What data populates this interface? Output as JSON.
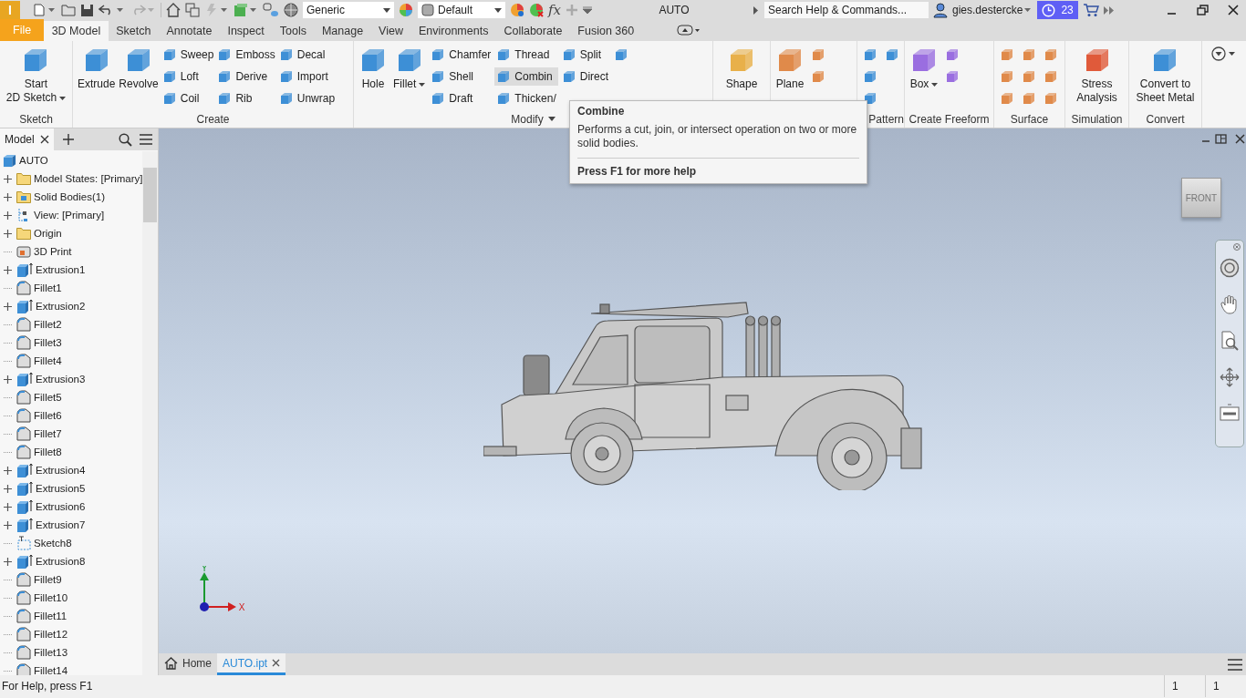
{
  "app": {
    "logo": "I",
    "title": "AUTO"
  },
  "quick_access": {
    "material": "Generic",
    "appearance": "Default",
    "function_label": "fx"
  },
  "search": {
    "placeholder": "Search Help & Commands..."
  },
  "user": {
    "name": "gies.destercke"
  },
  "trial_badge": "23",
  "menu_tabs": [
    {
      "label": "File",
      "kind": "file",
      "selected": false
    },
    {
      "label": "3D Model",
      "kind": "tab",
      "selected": true
    },
    {
      "label": "Sketch",
      "kind": "tab",
      "selected": false
    },
    {
      "label": "Annotate",
      "kind": "tab",
      "selected": false
    },
    {
      "label": "Inspect",
      "kind": "tab",
      "selected": false
    },
    {
      "label": "Tools",
      "kind": "tab",
      "selected": false
    },
    {
      "label": "Manage",
      "kind": "tab",
      "selected": false
    },
    {
      "label": "View",
      "kind": "tab",
      "selected": false
    },
    {
      "label": "Environments",
      "kind": "tab",
      "selected": false
    },
    {
      "label": "Collaborate",
      "kind": "tab",
      "selected": false
    },
    {
      "label": "Fusion 360",
      "kind": "tab",
      "selected": false
    }
  ],
  "ribbon_groups": [
    {
      "label": "Sketch",
      "menu": false,
      "tools": [
        {
          "kind": "large",
          "label": "Start\n2D Sketch",
          "dropdown": true,
          "hovered": false
        }
      ]
    },
    {
      "label": "Create",
      "menu": false,
      "tools": [
        {
          "kind": "large",
          "label": "Extrude",
          "dropdown": false,
          "hovered": false
        },
        {
          "kind": "large",
          "label": "Revolve",
          "dropdown": false,
          "hovered": false
        },
        {
          "kind": "stack",
          "items": [
            {
              "label": "Sweep",
              "hovered": false
            },
            {
              "label": "Loft",
              "hovered": false
            },
            {
              "label": "Coil",
              "hovered": false
            }
          ]
        },
        {
          "kind": "stack",
          "items": [
            {
              "label": "Emboss",
              "hovered": false
            },
            {
              "label": "Derive",
              "hovered": false
            },
            {
              "label": "Rib",
              "hovered": false
            }
          ]
        },
        {
          "kind": "stack",
          "items": [
            {
              "label": "Decal",
              "hovered": false
            },
            {
              "label": "Import",
              "hovered": false
            },
            {
              "label": "Unwrap",
              "hovered": false
            }
          ]
        }
      ]
    },
    {
      "label": "Modify",
      "menu": true,
      "tools": [
        {
          "kind": "large",
          "label": "Hole",
          "dropdown": false,
          "hovered": false
        },
        {
          "kind": "large",
          "label": "Fillet",
          "dropdown": true,
          "hovered": false
        },
        {
          "kind": "stack",
          "items": [
            {
              "label": "Chamfer",
              "hovered": false
            },
            {
              "label": "Shell",
              "hovered": false
            },
            {
              "label": "Draft",
              "hovered": false
            }
          ]
        },
        {
          "kind": "stack",
          "items": [
            {
              "label": "Thread",
              "hovered": false
            },
            {
              "label": "Combin",
              "hovered": true
            },
            {
              "label": "Thicken/",
              "hovered": false
            }
          ]
        },
        {
          "kind": "stack",
          "items": [
            {
              "label": "Split",
              "hovered": false
            },
            {
              "label": "Direct",
              "hovered": false
            }
          ]
        },
        {
          "kind": "stack",
          "items": [
            {
              "hovered": false
            }
          ]
        }
      ]
    },
    {
      "tools": [
        {
          "kind": "large",
          "label": "Shape",
          "dropdown": false,
          "hovered": false
        }
      ]
    },
    {
      "tools": [
        {
          "kind": "large",
          "label": "Plane",
          "dropdown": false,
          "hovered": false
        },
        {
          "kind": "stack",
          "items": [
            {
              "hovered": false
            },
            {
              "hovered": false
            }
          ]
        }
      ]
    },
    {
      "label": "Pattern",
      "menu": false,
      "tools": [
        {
          "kind": "stack",
          "items": [
            {
              "hovered": false
            },
            {
              "hovered": false
            },
            {
              "hovered": false
            }
          ]
        },
        {
          "kind": "stack",
          "items": [
            {
              "hovered": false
            }
          ]
        }
      ]
    },
    {
      "label": "Create Freeform",
      "menu": false,
      "tools": [
        {
          "kind": "large",
          "label": "Box",
          "dropdown": true,
          "hovered": false
        },
        {
          "kind": "stack",
          "items": [
            {
              "hovered": false
            },
            {
              "hovered": false
            }
          ]
        }
      ]
    },
    {
      "label": "Surface",
      "menu": false,
      "tools": [
        {
          "kind": "stack",
          "items": [
            {
              "hovered": false
            },
            {
              "hovered": false
            },
            {
              "hovered": false
            }
          ]
        },
        {
          "kind": "stack",
          "items": [
            {
              "hovered": false
            },
            {
              "hovered": false
            },
            {
              "hovered": false
            }
          ]
        },
        {
          "kind": "stack",
          "items": [
            {
              "hovered": false
            },
            {
              "hovered": false
            },
            {
              "hovered": false
            }
          ]
        }
      ]
    },
    {
      "label": "Simulation",
      "menu": false,
      "tools": [
        {
          "kind": "large",
          "label": "Stress\nAnalysis",
          "dropdown": false,
          "hovered": false
        }
      ]
    },
    {
      "label": "Convert",
      "menu": false,
      "tools": [
        {
          "kind": "large",
          "label": "Convert to\nSheet Metal",
          "dropdown": false,
          "hovered": false
        }
      ]
    }
  ],
  "tooltip": {
    "title": "Combine",
    "text": "Performs a cut, join, or intersect operation on two or more solid bodies.",
    "footer": "Press F1 for more help"
  },
  "browser": {
    "tab": "Model",
    "tree": {
      "label": "AUTO",
      "kind": "part",
      "children": [
        {
          "label": "Model States: [Primary]",
          "kind": "folder",
          "expandable": true
        },
        {
          "label": "Solid Bodies(1)",
          "kind": "bodies",
          "expandable": true
        },
        {
          "label": "View: [Primary]",
          "kind": "view",
          "expandable": true
        },
        {
          "label": "Origin",
          "kind": "folder",
          "expandable": true
        },
        {
          "label": "3D Print",
          "kind": "print",
          "expandable": false
        },
        {
          "label": "Extrusion1",
          "kind": "extrusion",
          "expandable": true
        },
        {
          "label": "Fillet1",
          "kind": "fillet",
          "expandable": false
        },
        {
          "label": "Extrusion2",
          "kind": "extrusion",
          "expandable": true
        },
        {
          "label": "Fillet2",
          "kind": "fillet",
          "expandable": false
        },
        {
          "label": "Fillet3",
          "kind": "fillet",
          "expandable": false
        },
        {
          "label": "Fillet4",
          "kind": "fillet",
          "expandable": false
        },
        {
          "label": "Extrusion3",
          "kind": "extrusion",
          "expandable": true
        },
        {
          "label": "Fillet5",
          "kind": "fillet",
          "expandable": false
        },
        {
          "label": "Fillet6",
          "kind": "fillet",
          "expandable": false
        },
        {
          "label": "Fillet7",
          "kind": "fillet",
          "expandable": false
        },
        {
          "label": "Fillet8",
          "kind": "fillet",
          "expandable": false
        },
        {
          "label": "Extrusion4",
          "kind": "extrusion",
          "expandable": true
        },
        {
          "label": "Extrusion5",
          "kind": "extrusion",
          "expandable": true
        },
        {
          "label": "Extrusion6",
          "kind": "extrusion",
          "expandable": true
        },
        {
          "label": "Extrusion7",
          "kind": "extrusion",
          "expandable": true
        },
        {
          "label": "Sketch8",
          "kind": "sketch",
          "expandable": false
        },
        {
          "label": "Extrusion8",
          "kind": "extrusion",
          "expandable": true
        },
        {
          "label": "Fillet9",
          "kind": "fillet",
          "expandable": false
        },
        {
          "label": "Fillet10",
          "kind": "fillet",
          "expandable": false
        },
        {
          "label": "Fillet11",
          "kind": "fillet",
          "expandable": false
        },
        {
          "label": "Fillet12",
          "kind": "fillet",
          "expandable": false
        },
        {
          "label": "Fillet13",
          "kind": "fillet",
          "expandable": false
        },
        {
          "label": "Fillet14",
          "kind": "fillet",
          "expandable": false
        }
      ]
    }
  },
  "viewcube": {
    "face": "FRONT"
  },
  "triad": {
    "y": "Y",
    "x": "X"
  },
  "document_tabs": [
    {
      "label": "Home",
      "kind": "home",
      "selected": false
    },
    {
      "label": "AUTO.ipt",
      "kind": "document",
      "selected": true
    }
  ],
  "status_bar": {
    "text": "For Help, press F1",
    "cells": [
      "1",
      "1"
    ]
  }
}
